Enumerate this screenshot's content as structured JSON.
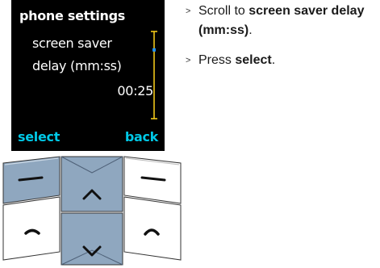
{
  "screen": {
    "title": "phone settings",
    "option_line1": "screen saver",
    "option_line2": "delay (mm:ss)",
    "value": "00:25",
    "softkey_left": "select",
    "softkey_right": "back",
    "scroll_position": 0.2,
    "softkey_color": "#00c8e6",
    "scrollbar_color": "#ffd21a",
    "scroll_marker_color": "#1e90ff"
  },
  "keypad": {
    "keys": [
      {
        "name": "left-softkey",
        "icon": "dash-icon"
      },
      {
        "name": "nav-up-key",
        "icon": "up-arrow-icon"
      },
      {
        "name": "right-softkey",
        "icon": "dash-icon"
      },
      {
        "name": "call-key",
        "icon": "phone-handset-icon"
      },
      {
        "name": "nav-down-key",
        "icon": "down-arrow-icon"
      },
      {
        "name": "end-key",
        "icon": "phone-handset-hangup-icon"
      }
    ],
    "highlight_color": "#8fa7bf"
  },
  "instructions": [
    {
      "prefix": "Scroll to ",
      "bold": "screen saver delay (mm:ss)",
      "suffix": "."
    },
    {
      "prefix": "Press ",
      "bold": "select",
      "suffix": "."
    }
  ],
  "bullet_glyph": ">"
}
